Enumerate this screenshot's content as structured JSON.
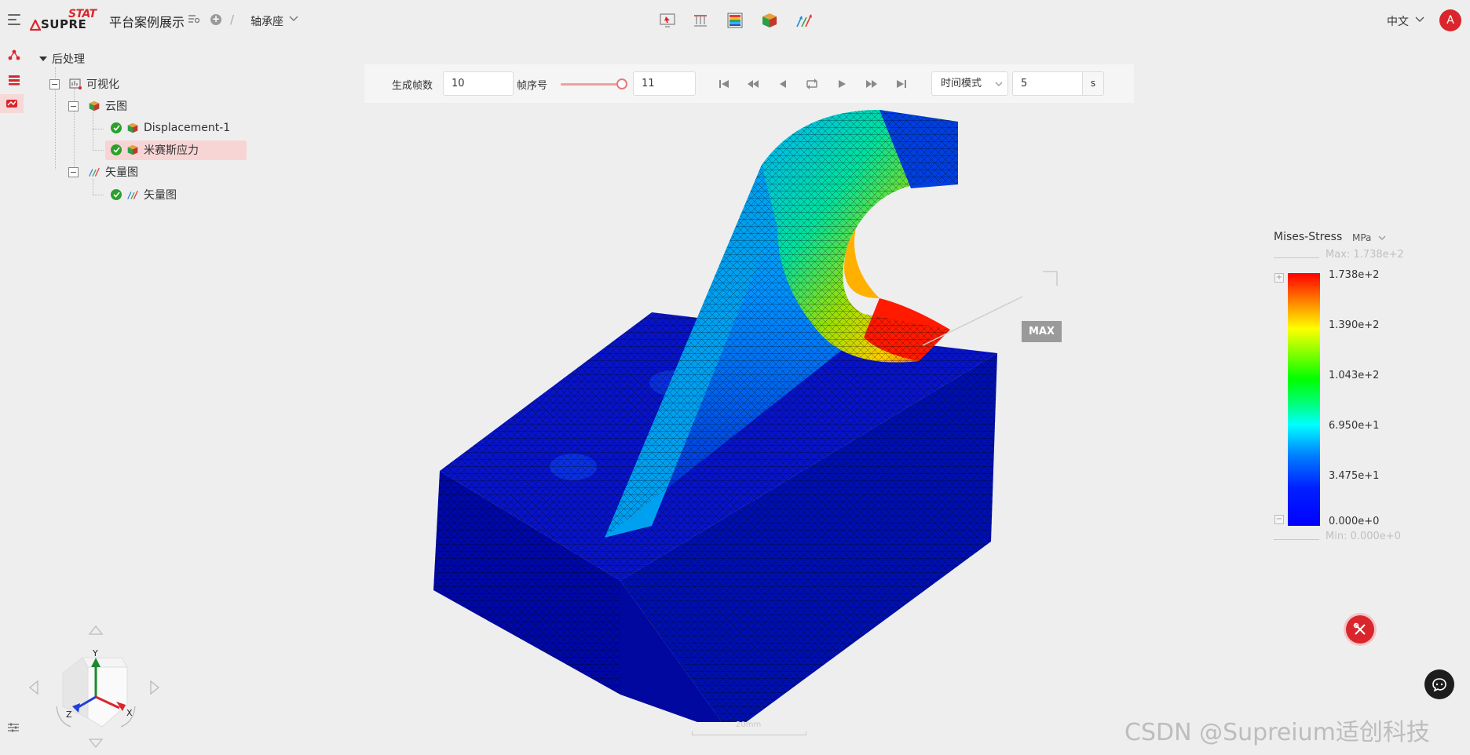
{
  "header": {
    "logo_top": "STAT",
    "logo_bottom": "SUPRE",
    "project_title": "平台案例展示",
    "model_name": "轴承座",
    "breadcrumb_separator": "/",
    "language": "中文",
    "avatar_initial": "A",
    "toolbar_icons": [
      "probe-icon",
      "constraint-icon",
      "contour-icon",
      "cube-icon",
      "vector-icon"
    ]
  },
  "tree": {
    "root": "后处理",
    "visualization": "可视化",
    "contour_group": "云图",
    "contour_items": [
      "Displacement-1",
      "米赛斯应力"
    ],
    "vector_group": "矢量图",
    "vector_items": [
      "矢量图"
    ]
  },
  "animation": {
    "frames_label": "生成帧数",
    "frames_value": "10",
    "frame_index_label": "帧序号",
    "frame_index_value": "11",
    "mode_value": "时间模式",
    "duration_value": "5",
    "duration_unit": "s"
  },
  "viewport": {
    "max_tag": "MAX",
    "scale_label": "20mm"
  },
  "legend": {
    "title": "Mises-Stress",
    "unit": "MPa",
    "max_text": "Max: 1.738e+2",
    "min_text": "Min: 0.000e+0",
    "ticks": [
      "1.738e+2",
      "1.390e+2",
      "1.043e+2",
      "6.950e+1",
      "3.475e+1",
      "0.000e+0"
    ]
  },
  "navcube": {
    "axis_x": "X",
    "axis_y": "Y",
    "axis_z": "Z"
  },
  "watermark": "CSDN @Supreium适创科技",
  "colors": {
    "brand": "#d9262c",
    "check": "#2aa12a",
    "selected_row": "#f7d5d5",
    "background": "#eeeeee"
  }
}
